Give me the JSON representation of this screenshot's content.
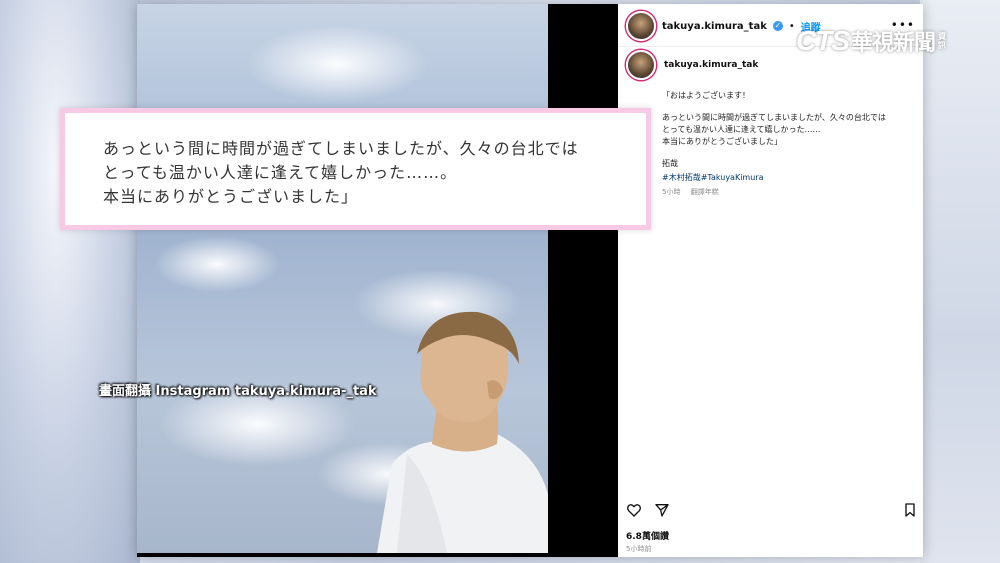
{
  "post": {
    "username": "takuya.kimura_tak",
    "follow_label": "追蹤",
    "separator": "•",
    "caption_username": "takuya.kimura_tak",
    "caption_greeting": "「おはようございます！",
    "caption_body": "あっという間に時間が過ぎてしまいましたが、久々の台北では\nとっても温かい人達に逢えて嬉しかった……\n本当にありがとうございました」",
    "caption_signature": "拓哉",
    "caption_tags": "#木村拓哉#TakuyaKimura",
    "caption_time": "5小時",
    "translate_label": "翻譯年糕",
    "likes": "6.8萬個讚",
    "posted_time": "5小時前"
  },
  "overlay": {
    "quote": "あっという間に時間が過ぎてしまいましたが、久々の台北では\nとっても温かい人達に逢えて嬉しかった……。\n本当にありがとうございました」",
    "source": "畫面翻攝 Instagram takuya.kimura-_tak"
  },
  "logo": {
    "cts": "CTS",
    "chinese": "華視新聞",
    "tag": "資訊"
  },
  "icons": [
    "more-icon",
    "heart-icon",
    "share-icon",
    "save-icon",
    "verified-badge-icon"
  ],
  "colors": {
    "follow": "#0095f6",
    "verified": "#3897f0",
    "quote_border": "#f7c9e4"
  }
}
